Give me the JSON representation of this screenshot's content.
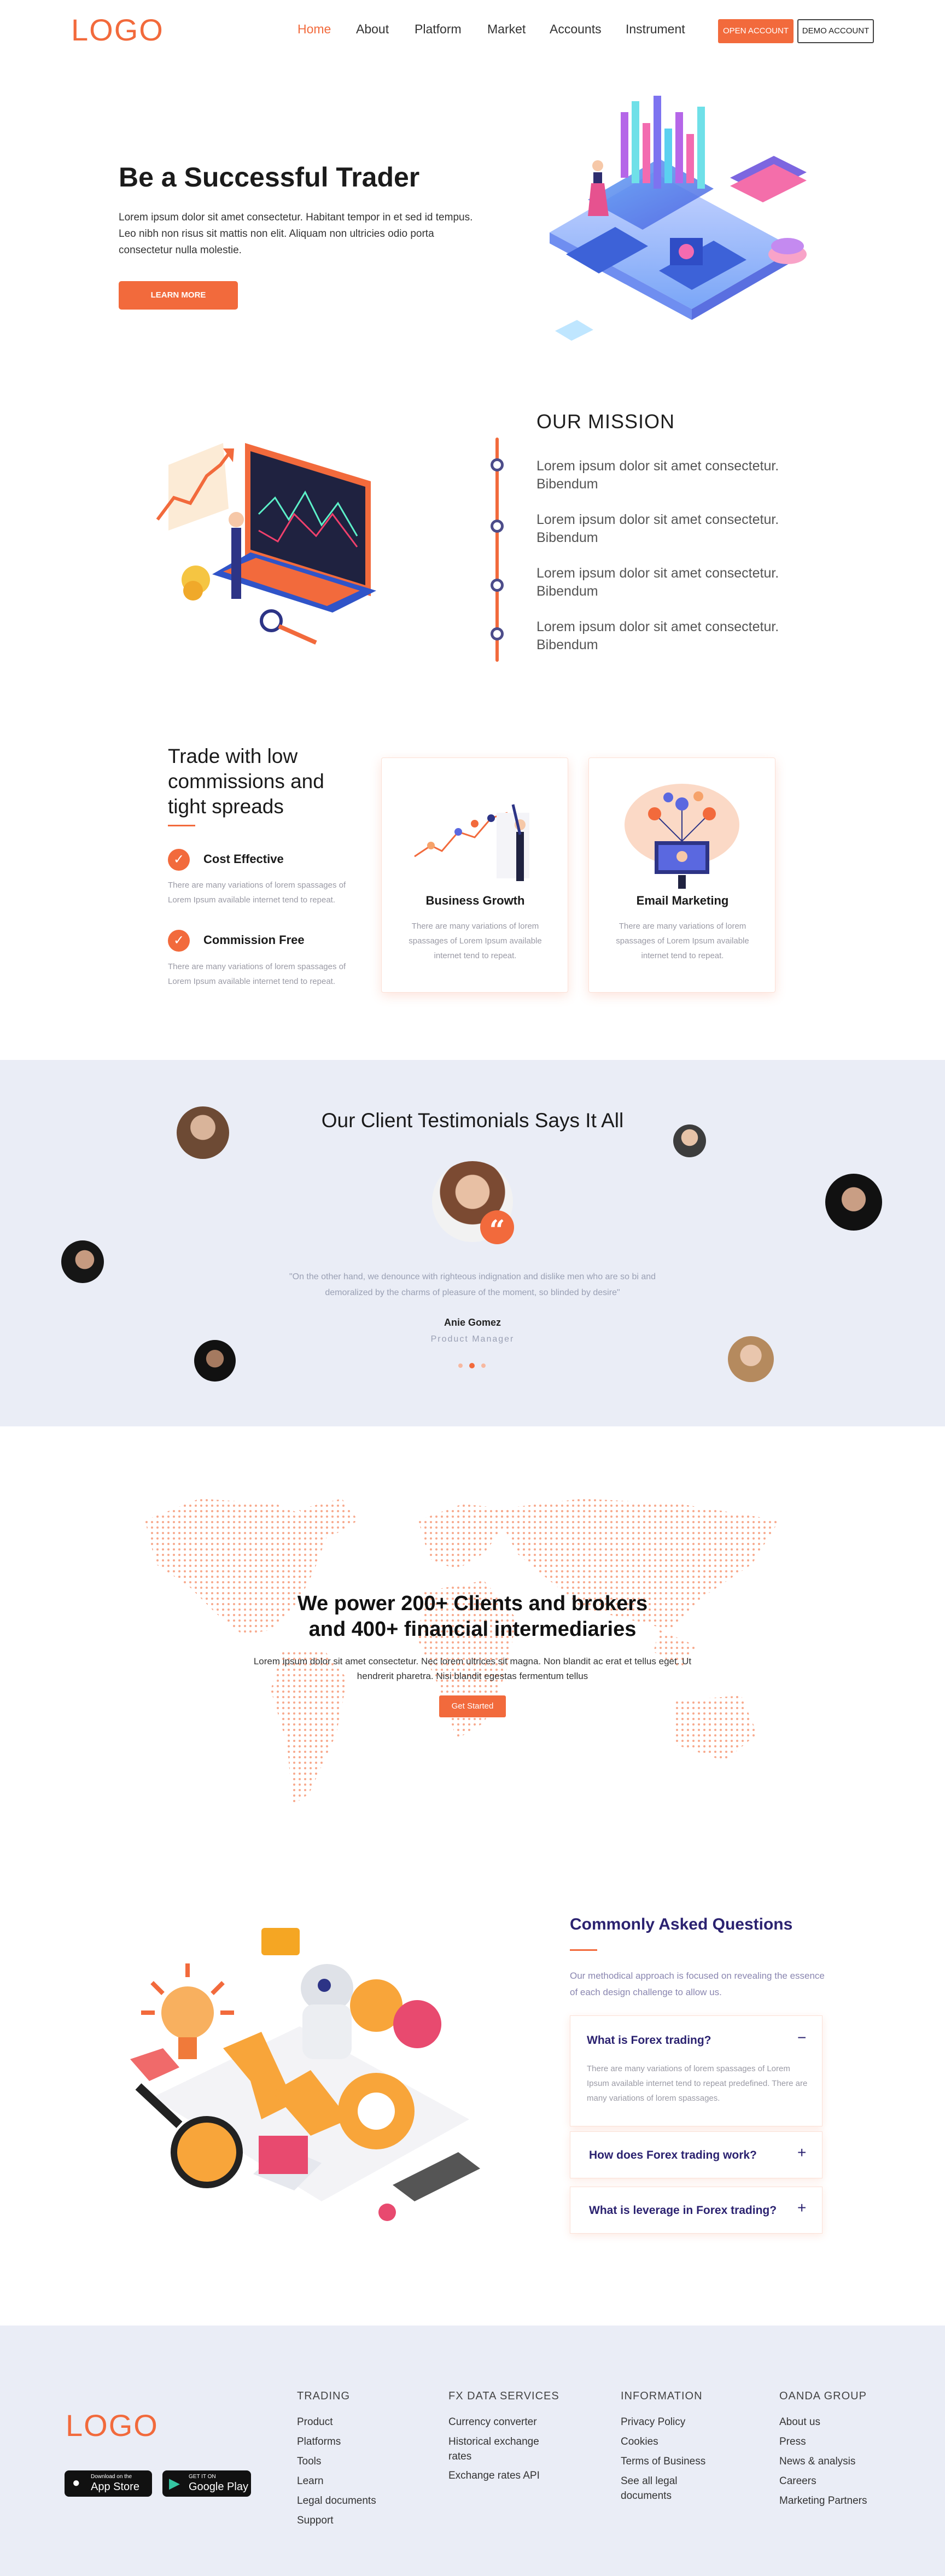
{
  "brand": {
    "logo_text": "LOGO",
    "accent": "#f26a3c",
    "navy": "#2b2270",
    "band_bg": "#eaedf6"
  },
  "nav": {
    "items": [
      "Home",
      "About",
      "Platform",
      "Market",
      "Accounts",
      "Instrument"
    ],
    "open_account": "OPEN ACCOUNT",
    "demo_account": "DEMO ACCOUNT"
  },
  "hero": {
    "title": "Be a Successful Trader",
    "text": "Lorem ipsum dolor sit amet consectetur. Habitant tempor in et sed id tempus. Leo nibh non risus sit mattis non elit. Aliquam non ultricies odio porta consectetur nulla molestie.",
    "cta": "LEARN MORE"
  },
  "mission": {
    "title": "OUR MISSION",
    "items": [
      "Lorem ipsum dolor sit amet consectetur. Bibendum",
      "Lorem ipsum dolor sit amet consectetur. Bibendum",
      "Lorem ipsum dolor sit amet consectetur. Bibendum",
      "Lorem ipsum dolor sit amet consectetur. Bibendum"
    ]
  },
  "features": {
    "title": "Trade with low commissions and tight spreads",
    "items": [
      {
        "title": "Cost Effective",
        "text": "There are many variations of lorem spassages of Lorem Ipsum available internet tend to repeat."
      },
      {
        "title": "Commission Free",
        "text": "There are many variations of lorem spassages of Lorem Ipsum available internet tend to repeat."
      }
    ],
    "cards": [
      {
        "title": "Business Growth",
        "text": "There are many variations of lorem spassages of Lorem Ipsum available internet tend to repeat."
      },
      {
        "title": "Email Marketing",
        "text": "There are many variations of lorem spassages of Lorem Ipsum available internet tend to repeat."
      }
    ]
  },
  "testimonials": {
    "title": "Our Client Testimonials Says It All",
    "quote_icon": "quote-icon",
    "quote": "\"On the other hand, we denounce with righteous indignation and dislike men who are so bi and demoralized by the charms of pleasure of the moment, so blinded by desire\"",
    "name": "Anie Gomez",
    "role": "Product Manager"
  },
  "stats": {
    "title_line1": "We power 200+ Clients and brokers",
    "title_line2": "and 400+ financial intermediaries",
    "text": "Lorem ipsum dolor sit amet consectetur. Nec lorem ultrices sit magna. Non blandit ac erat et tellus eget. Ut hendrerit pharetra. Nisi blandit egestas fermentum tellus",
    "cta": "Get Started"
  },
  "faq": {
    "title": "Commonly Asked Questions",
    "intro": "Our methodical approach is focused on revealing the essence of each design challenge to allow us.",
    "items": [
      {
        "question": "What is Forex trading?",
        "toggle": "−",
        "answer": "There are many variations of lorem spassages of Lorem Ipsum available internet tend to repeat predefined. There are many variations of lorem spassages."
      },
      {
        "question": "How does Forex trading work?",
        "toggle": "+"
      },
      {
        "question": "What is leverage in Forex trading?",
        "toggle": "+"
      }
    ]
  },
  "footer": {
    "logo_text": "LOGO",
    "app_store": {
      "small": "Download on the",
      "big": "App Store"
    },
    "google_play": {
      "small": "GET IT ON",
      "big": "Google Play"
    },
    "columns": [
      {
        "title": "TRADING",
        "links": [
          "Product",
          "Platforms",
          "Tools",
          "Learn",
          "Legal documents",
          "Support"
        ]
      },
      {
        "title": "FX DATA SERVICES",
        "links": [
          "Currency converter",
          "Historical exchange rates",
          "Exchange rates API"
        ]
      },
      {
        "title": "INFORMATION",
        "links": [
          "Privacy Policy",
          "Cookies",
          "Terms of Business",
          "See all legal documents"
        ]
      },
      {
        "title": "OANDA GROUP",
        "links": [
          "About us",
          "Press",
          "News & analysis",
          "Careers",
          "Marketing Partners"
        ]
      }
    ]
  }
}
